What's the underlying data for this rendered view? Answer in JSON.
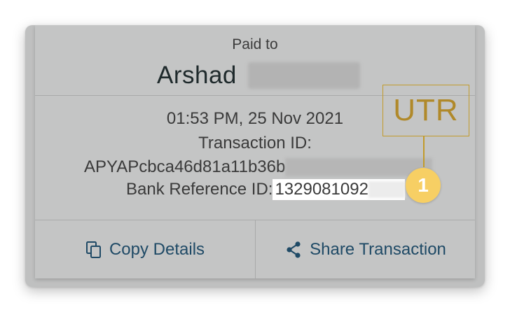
{
  "header": {
    "paid_to_label": "Paid to",
    "payee_name": "Arshad"
  },
  "details": {
    "datetime": "01:53 PM, 25 Nov 2021",
    "transaction_id_label": "Transaction ID:",
    "transaction_id_value": "APYAPcbca46d81a11b36b",
    "bank_reference_label": "Bank Reference ID:",
    "bank_reference_value": "1329081092"
  },
  "actions": {
    "copy_label": "Copy Details",
    "share_label": "Share Transaction"
  },
  "annotation": {
    "utr_label": "UTR",
    "marker_number": "1"
  },
  "icons": {
    "copy": "copy-icon",
    "share": "share-icon"
  },
  "colors": {
    "action_text": "#1f4a66",
    "annotation_gold": "#c29b2b",
    "marker_fill": "#f7cf64"
  }
}
